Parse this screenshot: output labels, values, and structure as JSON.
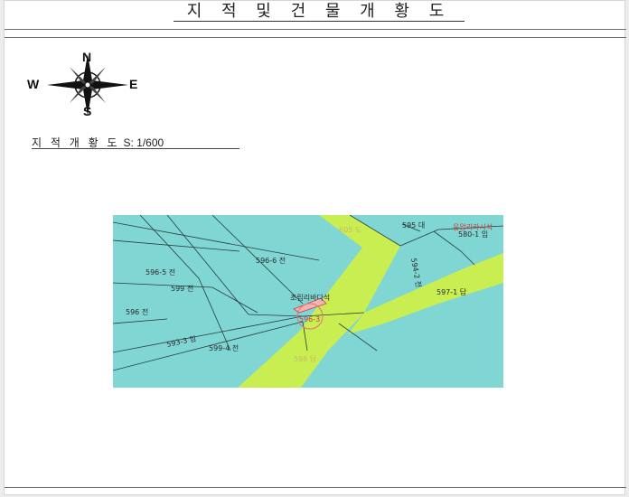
{
  "document": {
    "title": "지 적 및 건 물 개 황 도",
    "subtitle": "지 적 개 황 도",
    "scale": "S: 1/600"
  },
  "compass": {
    "north": "N",
    "south": "S",
    "east": "E",
    "west": "W"
  },
  "map": {
    "colors": {
      "parcel": "#7fd6d3",
      "road": "#c8ee52",
      "line": "#2a3b3b",
      "target": "#f0b4b4",
      "marker": "#e57373"
    },
    "labels": {
      "p595": "595 대",
      "p580_1": "580-1 임",
      "p605": "605 도",
      "p596_6": "596-6 전",
      "p596_5": "596-5 전",
      "p599": "599 전",
      "p596": "596 전",
      "p593_3": "593-3 임",
      "p599_4": "599-4 전",
      "p598": "598 답",
      "p597_1": "597-1 답",
      "p594_2": "594-2 전",
      "p596_3": "596-3",
      "subject": "조립리바다석",
      "neighbor": "응압리라시석"
    }
  }
}
